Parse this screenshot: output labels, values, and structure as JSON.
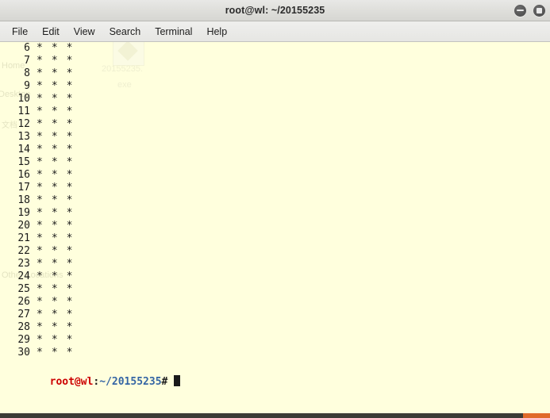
{
  "window": {
    "title": "root@wl: ~/20155235",
    "buttons": [
      {
        "name": "minimize",
        "glyph": "dash"
      },
      {
        "name": "maximize",
        "glyph": "square"
      }
    ]
  },
  "menubar": {
    "items": [
      {
        "label": "File"
      },
      {
        "label": "Edit"
      },
      {
        "label": "View"
      },
      {
        "label": "Search"
      },
      {
        "label": "Terminal"
      },
      {
        "label": "Help"
      }
    ]
  },
  "terminal": {
    "background_color": "#ffffdd",
    "foreground_color": "#1a1a1a",
    "rows": [
      {
        "lineno": "6",
        "content": "*  *  *"
      },
      {
        "lineno": "7",
        "content": "*  *  *"
      },
      {
        "lineno": "8",
        "content": "*  *  *"
      },
      {
        "lineno": "9",
        "content": "*  *  *"
      },
      {
        "lineno": "10",
        "content": "*  *  *"
      },
      {
        "lineno": "11",
        "content": "*  *  *"
      },
      {
        "lineno": "12",
        "content": "*  *  *"
      },
      {
        "lineno": "13",
        "content": "*  *  *"
      },
      {
        "lineno": "14",
        "content": "*  *  *"
      },
      {
        "lineno": "15",
        "content": "*  *  *"
      },
      {
        "lineno": "16",
        "content": "*  *  *"
      },
      {
        "lineno": "17",
        "content": "*  *  *"
      },
      {
        "lineno": "18",
        "content": "*  *  *"
      },
      {
        "lineno": "19",
        "content": "*  *  *"
      },
      {
        "lineno": "20",
        "content": "*  *  *"
      },
      {
        "lineno": "21",
        "content": "*  *  *"
      },
      {
        "lineno": "22",
        "content": "*  *  *"
      },
      {
        "lineno": "23",
        "content": "*  *  *"
      },
      {
        "lineno": "24",
        "content": "*  *  *"
      },
      {
        "lineno": "25",
        "content": "*  *  *"
      },
      {
        "lineno": "26",
        "content": "*  *  *"
      },
      {
        "lineno": "27",
        "content": "*  *  *"
      },
      {
        "lineno": "28",
        "content": "*  *  *"
      },
      {
        "lineno": "29",
        "content": "*  *  *"
      },
      {
        "lineno": "30",
        "content": "*  *  *"
      }
    ],
    "prompt": {
      "user_host": "root@wl",
      "separator": ":",
      "path": "~/20155235",
      "symbol": "#",
      "user_host_color": "#cc0000",
      "path_color": "#3465a4",
      "input": ""
    }
  },
  "ghost_overlay": {
    "labels": [
      {
        "text": "Home"
      },
      {
        "text": "Desktop"
      },
      {
        "text": "文档"
      },
      {
        "text": "Other Locations"
      },
      {
        "text": "20155235."
      },
      {
        "text": "exe"
      }
    ]
  },
  "bottom_bar": {
    "color": "#3c3b36",
    "accent_color": "#e06a2b"
  }
}
